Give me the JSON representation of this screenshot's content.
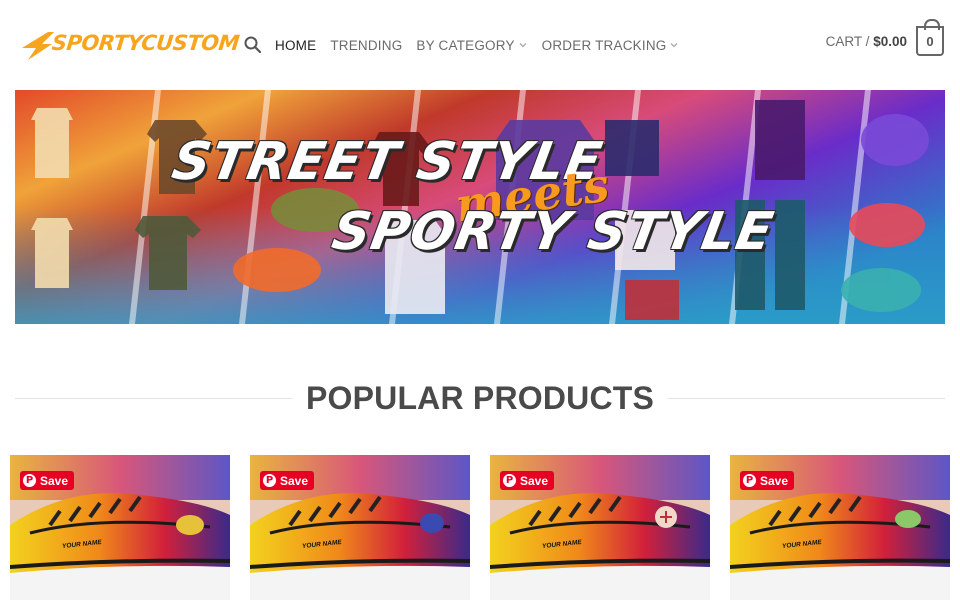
{
  "header": {
    "logo_text": "SPORTYCUSTOM",
    "nav": [
      {
        "label": "HOME",
        "active": true,
        "has_dropdown": false
      },
      {
        "label": "TRENDING",
        "active": false,
        "has_dropdown": false
      },
      {
        "label": "BY CATEGORY",
        "active": false,
        "has_dropdown": true
      },
      {
        "label": "ORDER TRACKING",
        "active": false,
        "has_dropdown": true
      }
    ],
    "cart": {
      "label": "CART /",
      "amount": "$0.00",
      "count": "0"
    },
    "icons": {
      "search": "search-icon",
      "dropdown": "chevron-down-icon",
      "cart": "cart-icon"
    }
  },
  "banner": {
    "line1": "STREET STYLE",
    "line2": "meets",
    "line3": "SPORTY STYLE"
  },
  "section": {
    "title": "POPULAR PRODUCTS"
  },
  "products": [
    {
      "save_label": "Save",
      "name_on_shoe": "YOUR NAME"
    },
    {
      "save_label": "Save",
      "name_on_shoe": "YOUR NAME"
    },
    {
      "save_label": "Save",
      "name_on_shoe": "YOUR NAME"
    },
    {
      "save_label": "Save",
      "name_on_shoe": "YOUR NAME"
    }
  ],
  "colors": {
    "brand": "#f7a51c",
    "pinterest": "#e60023",
    "nav_text": "#6b6b6b",
    "nav_active": "#222222"
  }
}
